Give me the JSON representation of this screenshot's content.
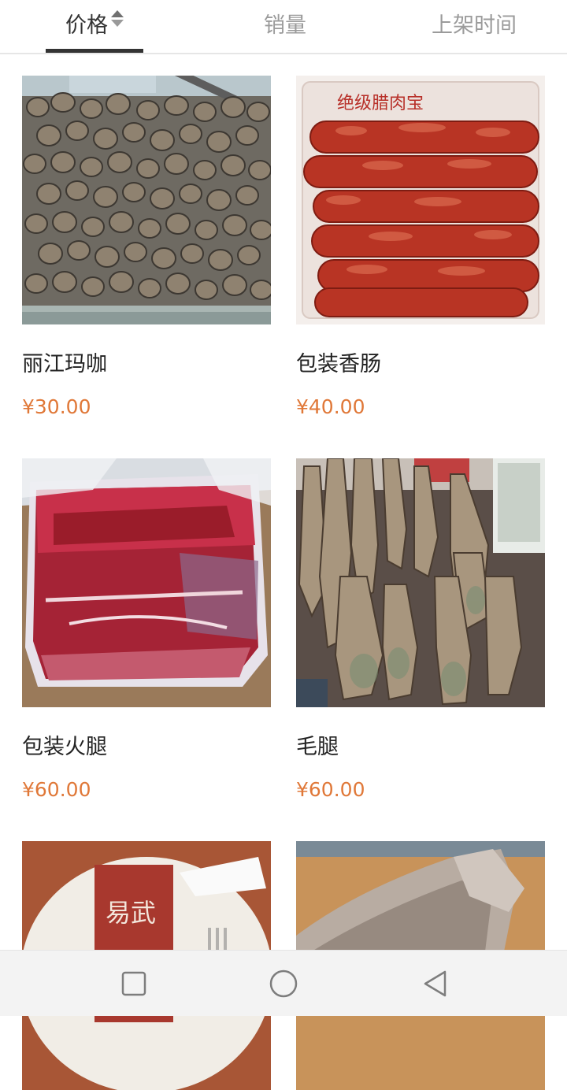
{
  "sort_tabs": [
    {
      "label": "价格",
      "active": true,
      "icon": "sort-icon"
    },
    {
      "label": "销量",
      "active": false
    },
    {
      "label": "上架时间",
      "active": false
    }
  ],
  "products": [
    {
      "name": "丽江玛咖",
      "price": "¥30.00",
      "image": "dried-maca-photo"
    },
    {
      "name": "包装香肠",
      "price": "¥40.00",
      "image": "packaged-sausage-photo",
      "package_text": "绝级腊肉宝"
    },
    {
      "name": "包装火腿",
      "price": "¥60.00",
      "image": "vacuum-packed-ham-photo"
    },
    {
      "name": "毛腿",
      "price": "¥60.00",
      "image": "hanging-cured-hams-photo"
    },
    {
      "name": "",
      "price": "",
      "image": "wrapped-tea-cake-photo",
      "package_text": "易武"
    },
    {
      "name": "",
      "price": "",
      "image": "sliced-ham-photo"
    }
  ],
  "system_nav": {
    "recent_icon": "square-recent-apps-icon",
    "home_icon": "circle-home-icon",
    "back_icon": "triangle-back-icon"
  },
  "colors": {
    "price": "#e07838",
    "active_tab": "#333333",
    "inactive_tab": "#9b9b9b"
  }
}
